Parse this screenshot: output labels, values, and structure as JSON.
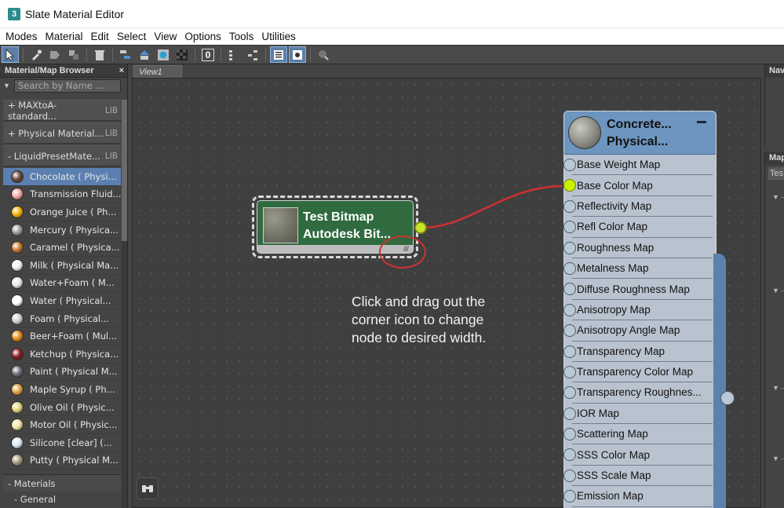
{
  "window": {
    "title": "Slate Material Editor",
    "icon": "3ds-max-icon"
  },
  "menu": [
    "Modes",
    "Material",
    "Edit",
    "Select",
    "View",
    "Options",
    "Tools",
    "Utilities"
  ],
  "toolbar": {
    "icons": [
      "select-arrow-icon",
      "eyedropper-icon",
      "put-to-scene-icon",
      "assign-icon",
      "delete-icon",
      "move-children-icon",
      "hide-node-icon",
      "show-map-icon",
      "background-checker-icon",
      "zero-icon",
      "layout-all-icon",
      "layout-children-icon",
      "material-browser-icon",
      "parameter-editor-icon",
      "select-by-material-icon"
    ],
    "zero_label": "0"
  },
  "browser": {
    "title": "Material/Map Browser",
    "search_placeholder": "Search by Name ...",
    "libraries": [
      {
        "label": "+ MAXtoA-standard...",
        "tag": "LIB"
      },
      {
        "label": "+ Physical Material...",
        "tag": "LIB"
      },
      {
        "label": "- LiquidPresetMate...",
        "tag": "LIB"
      }
    ],
    "materials": [
      {
        "label": "Chocolate  ( Physi...",
        "color": "#6b4a3a",
        "selected": true
      },
      {
        "label": "Transmission Fluid...",
        "color": "#f3a7a7"
      },
      {
        "label": "Orange Juice  ( Ph...",
        "color": "#f4b400"
      },
      {
        "label": "Mercury  ( Physica...",
        "color": "#9a9a9a"
      },
      {
        "label": "Caramel  ( Physica...",
        "color": "#c97a2c"
      },
      {
        "label": "Milk  ( Physical Ma...",
        "color": "#f2f2f2"
      },
      {
        "label": "Water+Foam  ( M...",
        "color": "#e8e8e8"
      },
      {
        "label": "Water  ( Physical...",
        "color": "#ffffff"
      },
      {
        "label": "Foam  ( Physical...",
        "color": "#cfcfcf"
      },
      {
        "label": "Beer+Foam  ( Mul...",
        "color": "#e88a1a"
      },
      {
        "label": "Ketchup  ( Physica...",
        "color": "#8a1a1a"
      },
      {
        "label": "Paint  ( Physical M...",
        "color": "#6a6e78"
      },
      {
        "label": "Maple Syrup  ( Ph...",
        "color": "#e0a445"
      },
      {
        "label": "Olive Oil  ( Physic...",
        "color": "#e4d27a"
      },
      {
        "label": "Motor Oil  ( Physic...",
        "color": "#f3e3a0"
      },
      {
        "label": "Silicone [clear]  (...",
        "color": "#d9eaf5"
      },
      {
        "label": "Putty  ( Physical M...",
        "color": "#a89878"
      }
    ],
    "group": "- Materials",
    "subgroup": "- General"
  },
  "view_tab": "View1",
  "bitmap_node": {
    "title_line1": "Test Bitmap",
    "title_line2": "Autodesk Bit..."
  },
  "annotation": "Click and drag out the corner icon to change node to desired width.",
  "physical_node": {
    "title_line1": "Concrete...",
    "title_line2": "Physical...",
    "slots": [
      "Base Weight Map",
      "Base Color Map",
      "Reflectivity Map",
      "Refl Color Map",
      "Roughness Map",
      "Metalness Map",
      "Diffuse Roughness Map",
      "Anisotropy Map",
      "Anisotropy Angle Map",
      "Transparency Map",
      "Transparency Color Map",
      "Transparency  Roughnes...",
      "IOR Map",
      "Scattering Map",
      "SSS Color Map",
      "SSS Scale Map",
      "Emission Map"
    ],
    "connected_slot": "Base Color Map"
  },
  "right_panels": {
    "nav_title": "Nav",
    "map_title": "Map",
    "map_field": "Tes"
  },
  "colors": {
    "accent": "#5b7fb0",
    "bitmap_node": "#2f6b3f",
    "physical_head": "#6d95bf",
    "wire": "#d0302f",
    "port_active": "#c8e62a"
  }
}
